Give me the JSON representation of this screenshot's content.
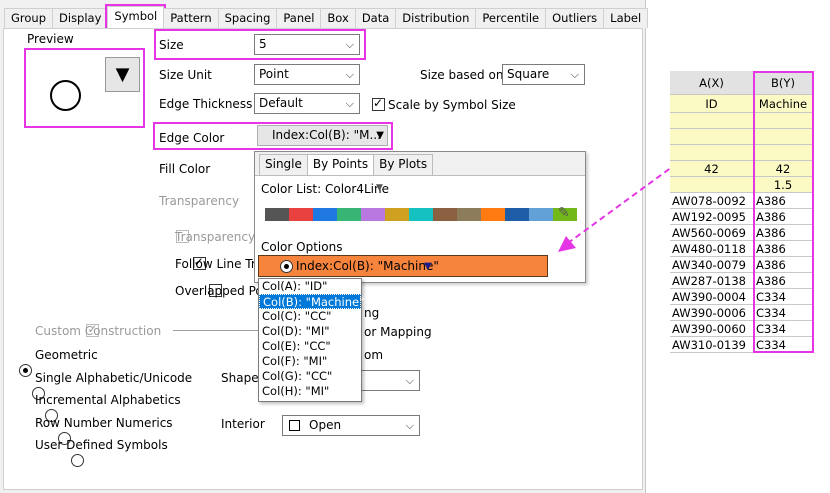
{
  "tabs": [
    "Group",
    "Display",
    "Symbol",
    "Pattern",
    "Spacing",
    "Panel",
    "Box",
    "Data",
    "Distribution",
    "Percentile",
    "Outliers",
    "Label"
  ],
  "preview": {
    "label": "Preview",
    "button_glyph": "▼"
  },
  "size": {
    "label": "Size",
    "value": "5"
  },
  "size_unit": {
    "label": "Size Unit",
    "value": "Point"
  },
  "size_based_on": {
    "label": "Size based on",
    "value": "Square"
  },
  "edge_thickness": {
    "label": "Edge Thickness",
    "value": "Default"
  },
  "scale_by_symbol_size": {
    "label": "Scale by Symbol Size",
    "checked": true
  },
  "edge_color": {
    "label": "Edge Color",
    "value": "Index:Col(B): \"M..."
  },
  "fill_color": {
    "label": "Fill Color"
  },
  "transparency": {
    "label": "Transparency"
  },
  "transparency_for": {
    "label": "Transparency fo",
    "checked": false
  },
  "follow_line": {
    "label": "Follow Line Tra",
    "checked": true
  },
  "overlapped": {
    "label": "Overlapped Poi",
    "checked": false
  },
  "custom_construction": {
    "label": "Custom Construction",
    "checked": true
  },
  "radios": [
    {
      "label": "Geometric",
      "selected": true
    },
    {
      "label": "Single Alphabetic/Unicode",
      "selected": false
    },
    {
      "label": "Incremental Alphabetics",
      "selected": false
    },
    {
      "label": "Row Number Numerics",
      "selected": false
    },
    {
      "label": "User Defined Symbols",
      "selected": false
    }
  ],
  "shape": {
    "label": "Shape"
  },
  "interior": {
    "label": "Interior",
    "value": "Open"
  },
  "popup": {
    "tabs": [
      "Single",
      "By Points",
      "By Plots"
    ],
    "color_list_label": "Color List: Color4Line",
    "colors": [
      "#555555",
      "#e94040",
      "#1f77e0",
      "#37b574",
      "#b878e0",
      "#d0a020",
      "#14c0c0",
      "#8a6040",
      "#8c7c5c",
      "#ff7a10",
      "#1e5ea8",
      "#62a0d8",
      "#72b81a"
    ],
    "color_options_label": "Color Options",
    "selected_option": "Index:Col(B): \"Machine\"",
    "highlight_color": "#f6843c",
    "behind_texts": [
      "ng",
      "or Mapping",
      "om"
    ]
  },
  "column_list": [
    {
      "label": "Col(A): \"ID\"",
      "selected": false
    },
    {
      "label": "Col(B): \"Machine\"",
      "selected": true
    },
    {
      "label": "Col(C): \"CC\"",
      "selected": false
    },
    {
      "label": "Col(D): \"MI\"",
      "selected": false
    },
    {
      "label": "Col(E): \"CC\"",
      "selected": false
    },
    {
      "label": "Col(F): \"MI\"",
      "selected": false
    },
    {
      "label": "Col(G): \"CC\"",
      "selected": false
    },
    {
      "label": "Col(H): \"MI\"",
      "selected": false
    }
  ],
  "sheet": {
    "headers": [
      "A(X)",
      "B(Y)"
    ],
    "long_names": [
      "ID",
      "Machine"
    ],
    "extra_rows": [
      [
        "42",
        "42"
      ],
      [
        "",
        "1.5"
      ]
    ],
    "rows": [
      [
        "AW078-0092",
        "A386"
      ],
      [
        "AW192-0095",
        "A386"
      ],
      [
        "AW560-0069",
        "A386"
      ],
      [
        "AW480-0118",
        "A386"
      ],
      [
        "AW340-0079",
        "A386"
      ],
      [
        "AW287-0138",
        "A386"
      ],
      [
        "AW390-0004",
        "C334"
      ],
      [
        "AW390-0006",
        "C334"
      ],
      [
        "AW390-0060",
        "C334"
      ],
      [
        "AW310-0139",
        "C334"
      ]
    ]
  }
}
